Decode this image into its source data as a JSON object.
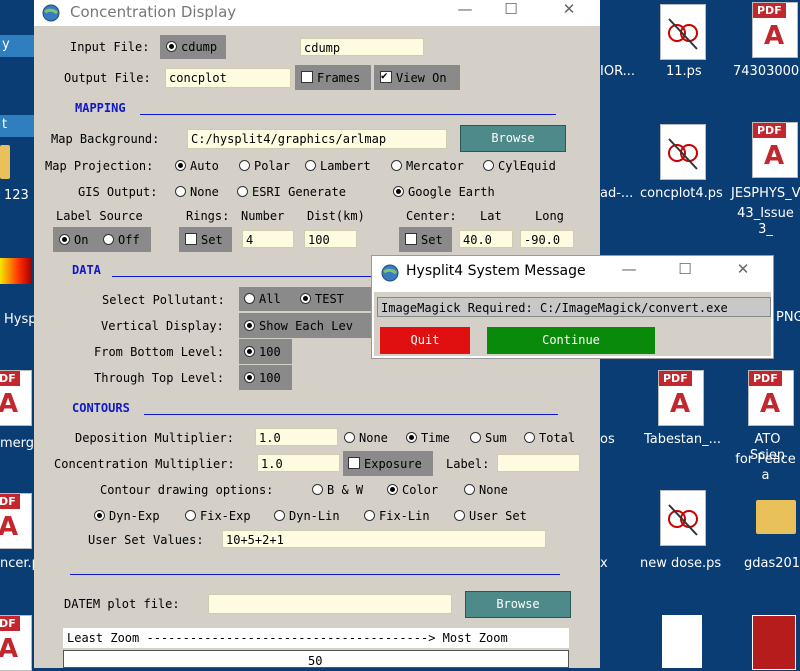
{
  "desktop": {
    "left_icons": [
      {
        "label": "123"
      },
      {
        "label": "Hysp"
      },
      {
        "label": "merg"
      },
      {
        "label": "ncer.p"
      }
    ],
    "left_partial_window": {
      "line1": "y",
      "line2": "t"
    },
    "top_icons": [
      {
        "label": "11.ps"
      },
      {
        "label": "74303000"
      },
      {
        "label": "IOR..."
      }
    ],
    "middle_icons": [
      {
        "label": "concplot4.ps"
      },
      {
        "label": "JESPHYS_V"
      },
      {
        "label": "43_Issue 3_"
      },
      {
        "label": "ad-..."
      }
    ],
    "right_icons": [
      {
        "label": "Tabestan_..."
      },
      {
        "label": "ATO Scien"
      },
      {
        "label": "for Peace a"
      },
      {
        "label": "new dose.ps"
      },
      {
        "label": "gdas201"
      },
      {
        "label": "PNG"
      },
      {
        "label": "os"
      },
      {
        "label": "x"
      }
    ]
  },
  "main_window": {
    "title": "Concentration Display",
    "title_partial": "hysplit4",
    "input_file": {
      "label": "Input File:",
      "radio_label": "cdump",
      "value": "cdump"
    },
    "output_file": {
      "label": "Output File:",
      "value": "concplot",
      "frames_label": "Frames",
      "viewon_label": "View On"
    },
    "mapping": {
      "title": "MAPPING",
      "background_label": "Map Background:",
      "background_value": "C:/hysplit4/graphics/arlmap",
      "browse_label": "Browse",
      "projection_label": "Map Projection:",
      "projection_options": [
        "Auto",
        "Polar",
        "Lambert",
        "Mercator",
        "CylEquid"
      ],
      "gis_label": "GIS Output:",
      "gis_options": [
        "None",
        "ESRI Generate",
        "Google Earth"
      ],
      "label_source": {
        "label": "Label Source",
        "on": "On",
        "off": "Off"
      },
      "rings": {
        "label": "Rings:",
        "number_label": "Number",
        "dist_label": "Dist(km)",
        "set_label": "Set",
        "number": "4",
        "dist": "100"
      },
      "center": {
        "label": "Center:",
        "lat_label": "Lat",
        "long_label": "Long",
        "set_label": "Set",
        "lat": "40.0",
        "long": "-90.0"
      }
    },
    "data": {
      "title": "DATA",
      "pollutant_label": "Select Pollutant:",
      "pollutant_options": [
        "All",
        "TEST"
      ],
      "vertical_label": "Vertical Display:",
      "vertical_value": "Show Each Lev",
      "bottom_label": "From Bottom Level:",
      "bottom_value": "100",
      "top_label": "Through Top Level:",
      "top_value": "100"
    },
    "contours": {
      "title": "CONTOURS",
      "deposition_label": "Deposition Multiplier:",
      "deposition_value": "1.0",
      "deposition_options": [
        "None",
        "Time",
        "Sum",
        "Total"
      ],
      "concentration_label": "Concentration Multiplier:",
      "concentration_value": "1.0",
      "exposure_label": "Exposure",
      "label_label": "Label:",
      "drawing_label": "Contour drawing options:",
      "drawing_options": [
        "B & W",
        "Color",
        "None"
      ],
      "levels_options": [
        "Dyn-Exp",
        "Fix-Exp",
        "Dyn-Lin",
        "Fix-Lin",
        "User Set"
      ],
      "user_set_label": "User Set Values:",
      "user_set_value": "10+5+2+1"
    },
    "datem": {
      "label": "DATEM plot file:",
      "value": "",
      "browse_label": "Browse"
    },
    "zoom": {
      "header": "Least Zoom ---------------------------------------> Most Zoom",
      "value": "50"
    }
  },
  "dialog": {
    "title": "Hysplit4 System Message",
    "message": "ImageMagick Required: C:/ImageMagick/convert.exe",
    "quit_label": "Quit",
    "continue_label": "Continue"
  },
  "colors": {
    "desktop": "#0a3d73",
    "window": "#d4d0c8",
    "field": "#fffbe0",
    "button": "#4f8a8b",
    "section": "#1018c8",
    "quit": "#e01010",
    "continue": "#0a8a0a"
  }
}
